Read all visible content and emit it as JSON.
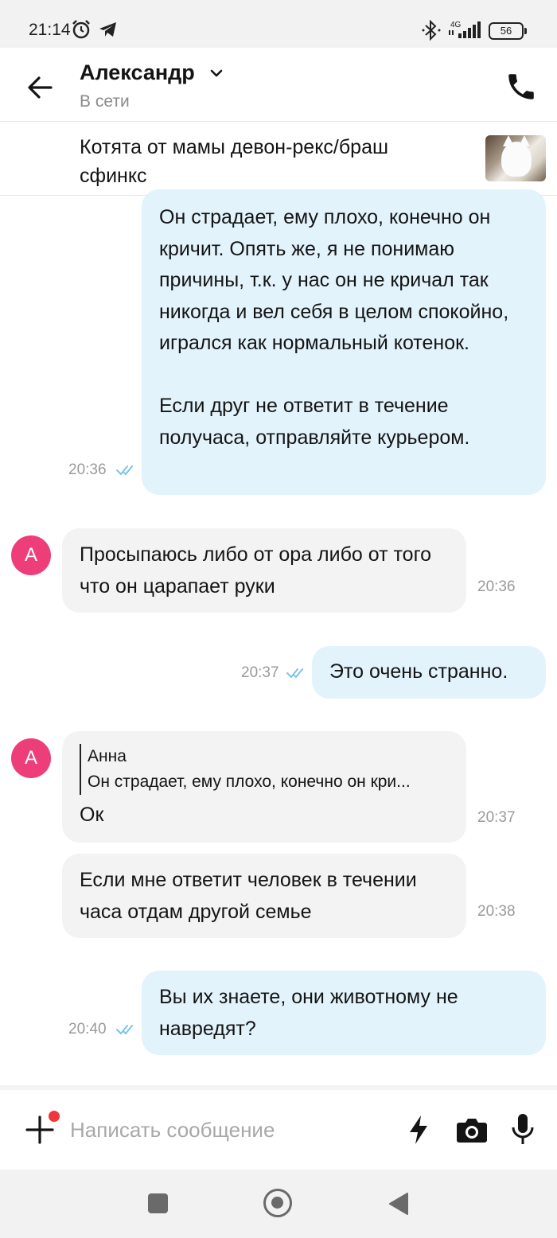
{
  "status_bar": {
    "time": "21:14",
    "network": "4G",
    "battery": "56"
  },
  "header": {
    "contact_name": "Александр",
    "contact_status": "В сети"
  },
  "listing": {
    "title": "Котята от мамы девон-рекс/браш сфинкс"
  },
  "messages": [
    {
      "direction": "outgoing",
      "text": "Он страдает, ему плохо, конечно он кричит. Опять же, я не понимаю причины, т.к. у нас он не кричал так никогда и вел себя в целом спокойно, игрался как нормальный котенок.\n\nЕсли друг не ответит в течение получаса, отправляйте курьером.",
      "time": "20:36",
      "read": true
    },
    {
      "direction": "incoming",
      "avatar": "А",
      "text": "Просыпаюсь либо от ора либо от того что он царапает руки",
      "time": "20:36"
    },
    {
      "direction": "outgoing",
      "text": "Это очень странно.",
      "time": "20:37",
      "read": true
    },
    {
      "direction": "incoming",
      "avatar": "А",
      "reply_to": {
        "author": "Анна",
        "snippet": "Он страдает, ему плохо, конечно он кри..."
      },
      "text": "Ок",
      "time": "20:37"
    },
    {
      "direction": "incoming",
      "text": "Если мне ответит человек в течении часа отдам другой семье",
      "time": "20:38"
    },
    {
      "direction": "outgoing",
      "text": "Вы их знаете, они животному не навредят?",
      "time": "20:40",
      "read": true
    }
  ],
  "composer": {
    "placeholder": "Написать сообщение",
    "value": ""
  },
  "colors": {
    "outgoing_bubble": "#e3f3fc",
    "incoming_bubble": "#f3f3f3",
    "avatar": "#ee3e7a",
    "read_ticks": "#7cc3ea",
    "notification_dot": "#f0353d"
  }
}
